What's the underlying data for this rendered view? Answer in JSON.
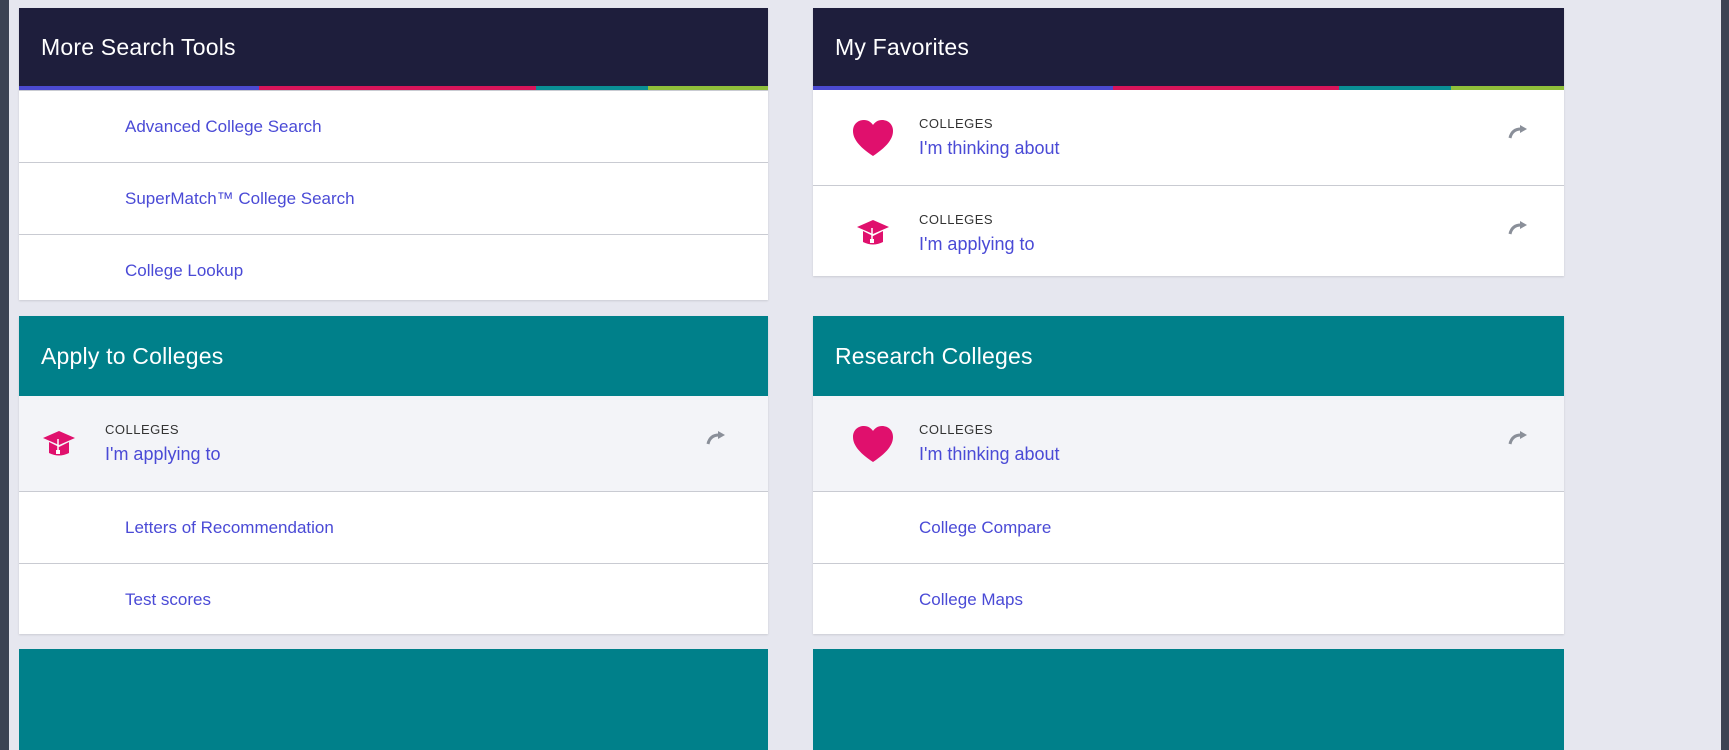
{
  "colors": {
    "navy": "#1e1e3c",
    "teal": "#00808a",
    "link": "#4a4ad6",
    "pink": "#e0106d",
    "stripe": [
      "#4b4ad1",
      "#d8155a",
      "#0a8f95",
      "#8fbf3a"
    ]
  },
  "more_search_tools": {
    "title": "More Search Tools",
    "links": [
      {
        "label": "Advanced College Search"
      },
      {
        "label": "SuperMatch™ College Search"
      },
      {
        "label": "College Lookup"
      }
    ]
  },
  "my_favorites": {
    "title": "My Favorites",
    "items": [
      {
        "category": "COLLEGES",
        "label": "I'm thinking about",
        "icon": "heart-icon"
      },
      {
        "category": "COLLEGES",
        "label": "I'm applying to",
        "icon": "graduation-cap-icon"
      }
    ]
  },
  "apply_to_colleges": {
    "title": "Apply to Colleges",
    "favorite": {
      "category": "COLLEGES",
      "label": "I'm applying to",
      "icon": "graduation-cap-icon"
    },
    "links": [
      {
        "label": "Letters of Recommendation"
      },
      {
        "label": "Test scores"
      }
    ]
  },
  "research_colleges": {
    "title": "Research Colleges",
    "favorite": {
      "category": "COLLEGES",
      "label": "I'm thinking about",
      "icon": "heart-icon"
    },
    "links": [
      {
        "label": "College Compare"
      },
      {
        "label": "College Maps"
      }
    ]
  }
}
